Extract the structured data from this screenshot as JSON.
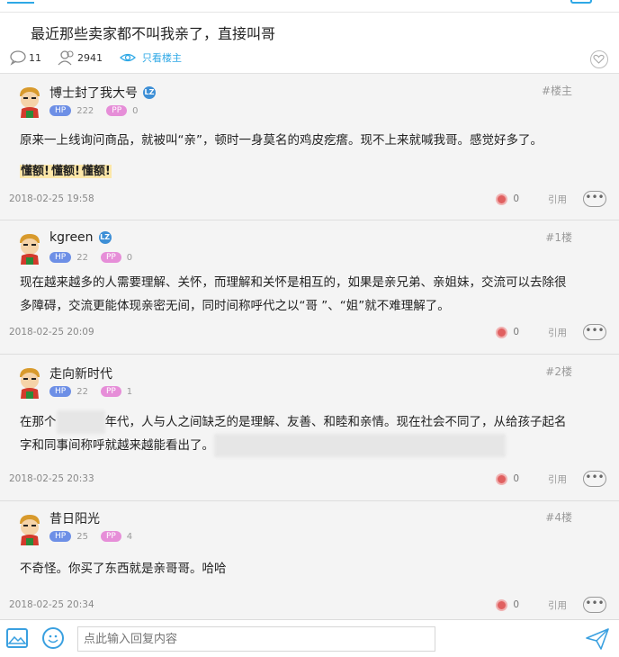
{
  "post": {
    "title": "最近那些卖家都不叫我亲了，直接叫哥",
    "comment_count": "11",
    "view_count": "2941",
    "owner_only_label": "只看楼主"
  },
  "floors": [
    {
      "username": "博士封了我大号",
      "is_lz": true,
      "lz_badge": "LZ",
      "hp_label": "HP",
      "hp_value": "222",
      "pp_label": "PP",
      "pp_value": "0",
      "floor_label": "#楼主",
      "content": "原来一上线询问商品，就被叫“亲”，顿时一身莫名的鸡皮疙瘩。现不上来就喊我哥。感觉好多了。",
      "sticker": [
        "懂额!",
        "懂额!",
        "懂额!"
      ],
      "date": "2018-02-25 19:58",
      "likes": "0",
      "reply_label": "引用",
      "more_label": "•••"
    },
    {
      "username": "kgreen",
      "is_lz": true,
      "lz_badge": "LZ",
      "hp_label": "HP",
      "hp_value": "22",
      "pp_label": "PP",
      "pp_value": "0",
      "floor_label": "#1楼",
      "content_line1": "现在越来越多的人需要理解、关怀，而理解和关怀是相互的，如果是亲兄弟、亲姐妹，交流可以去除很",
      "content_line2": "多障碍，交流更能体现亲密无间，同时间称呼代之以“哥 ”、“姐”就不难理解了。",
      "date": "2018-02-25 20:09",
      "likes": "0",
      "reply_label": "引用",
      "more_label": "•••"
    },
    {
      "username": "走向新时代",
      "is_lz": false,
      "hp_label": "HP",
      "hp_value": "22",
      "pp_label": "PP",
      "pp_value": "1",
      "floor_label": "#2楼",
      "content_a": "在那个",
      "content_b": "年代，人与人之间缺乏的是理解、友善、和睦和亲情。现在社会不同了，从给孩子起名",
      "content_line2": "字和同事间称呼就越来越能看出了。",
      "date": "2018-02-25 20:33",
      "likes": "0",
      "reply_label": "引用",
      "more_label": "•••"
    },
    {
      "username": "昔日阳光",
      "is_lz": false,
      "hp_label": "HP",
      "hp_value": "25",
      "pp_label": "PP",
      "pp_value": "4",
      "floor_label": "#4楼",
      "content": "不奇怪。你买了东西就是亲哥哥。哈哈",
      "date": "2018-02-25 20:34",
      "likes": "0",
      "reply_label": "引用",
      "more_label": "•••"
    }
  ],
  "reply_bar": {
    "placeholder": "点此输入回复内容"
  },
  "colors": {
    "accent": "#2ea8e6",
    "hp": "#6d8fe6",
    "pp": "#e68ed8",
    "like": "#e06060"
  },
  "icons": [
    "comment-icon",
    "views-icon",
    "eye-icon",
    "heart-icon",
    "avatar",
    "like-icon",
    "more-icon",
    "image-icon",
    "smile-icon",
    "send-icon"
  ]
}
